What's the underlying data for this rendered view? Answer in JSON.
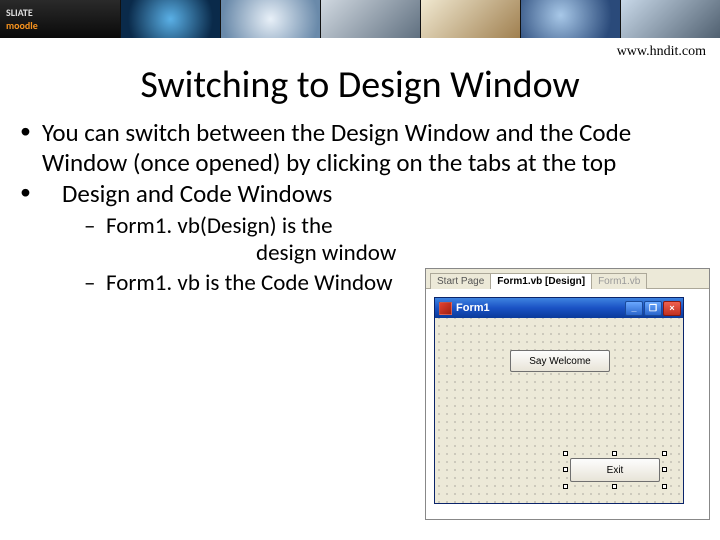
{
  "banner": {
    "logo_part1": "SLIATE",
    "logo_part2": "moodle"
  },
  "url": "www.hndit.com",
  "title": "Switching to Design Window",
  "bullets": {
    "b1": "You can switch between the Design Window and the Code Window (once opened) by clicking on the tabs at the top",
    "b2": "Design and Code Windows",
    "sub1a": "Form1. vb(Design) is the",
    "sub1b": "design window",
    "sub2": "Form1. vb is the Code Window"
  },
  "vb": {
    "tabs": {
      "start": "Start Page",
      "active": "Form1.vb [Design]",
      "code": "Form1.vb"
    },
    "form_title": "Form1",
    "winbtn_min": "_",
    "winbtn_max": "❐",
    "winbtn_close": "×",
    "btn_welcome": "Say Welcome",
    "btn_exit": "Exit"
  }
}
